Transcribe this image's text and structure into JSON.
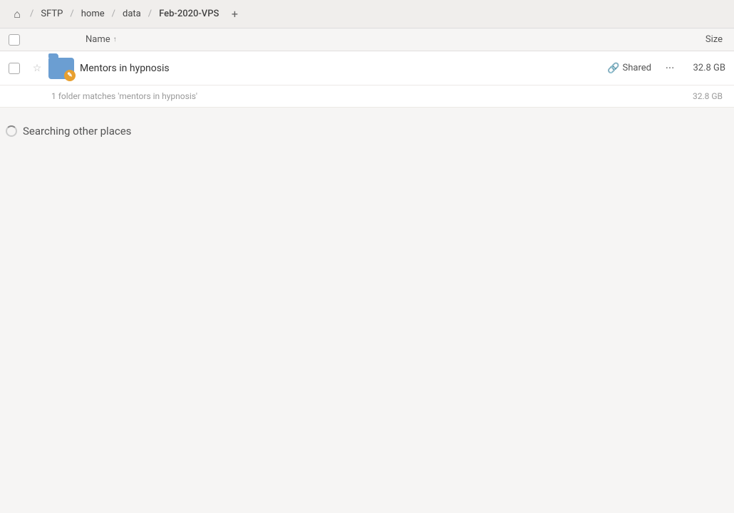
{
  "header": {
    "home_icon": "⌂",
    "breadcrumbs": [
      {
        "label": "SFTP",
        "id": "sftp"
      },
      {
        "label": "home",
        "id": "home"
      },
      {
        "label": "data",
        "id": "data"
      },
      {
        "label": "Feb-2020-VPS",
        "id": "feb-2020-vps"
      }
    ],
    "add_tab_icon": "+"
  },
  "columns": {
    "name_label": "Name",
    "sort_arrow": "↑",
    "size_label": "Size"
  },
  "files": [
    {
      "name": "Mentors in hypnosis",
      "shared": "Shared",
      "size": "32.8 GB",
      "starred": false
    }
  ],
  "search_status": {
    "text": "1 folder matches 'mentors in hypnosis'",
    "size": "32.8 GB"
  },
  "searching_other": {
    "label": "Searching other places"
  }
}
